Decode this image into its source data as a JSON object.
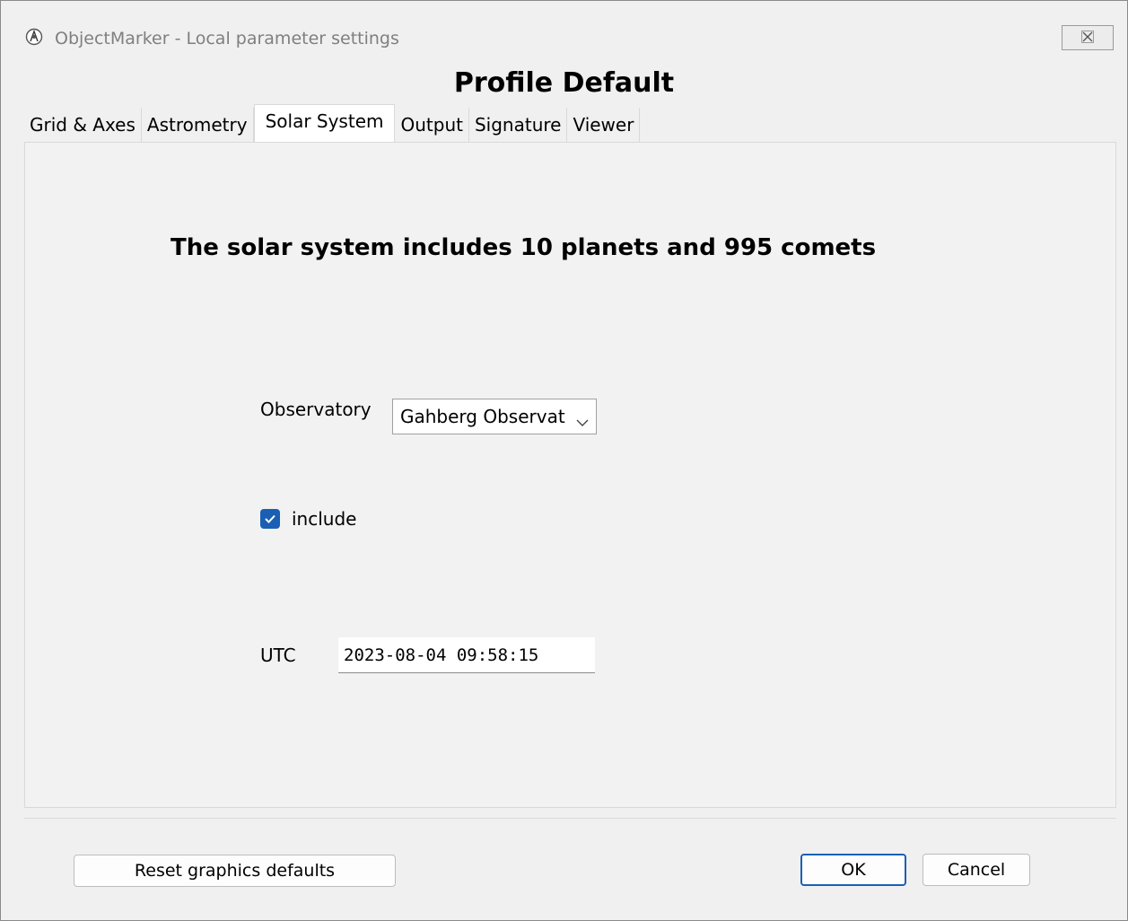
{
  "window": {
    "title": "ObjectMarker - Local parameter settings"
  },
  "profile": {
    "title": "Profile Default"
  },
  "tabs": [
    {
      "label": "Grid & Axes"
    },
    {
      "label": "Astrometry"
    },
    {
      "label": "Solar System"
    },
    {
      "label": "Output"
    },
    {
      "label": "Signature"
    },
    {
      "label": "Viewer"
    }
  ],
  "solar_system": {
    "heading": "The solar system includes 10 planets and 995 comets",
    "observatory_label": "Observatory",
    "observatory_value": "Gahberg Observatory",
    "observatory_display": "Gahberg Observat",
    "include_label": "include",
    "include_checked": true,
    "utc_label": "UTC",
    "utc_value": "2023-08-04 09:58:15"
  },
  "buttons": {
    "reset_label": "Reset graphics defaults",
    "ok_label": "OK",
    "cancel_label": "Cancel"
  },
  "colors": {
    "accent": "#1a5fb4"
  },
  "icons": {
    "app": "objectmarker-app-icon",
    "close": "close-icon",
    "dropdown": "chevron-down-icon",
    "check": "checkmark-icon"
  }
}
